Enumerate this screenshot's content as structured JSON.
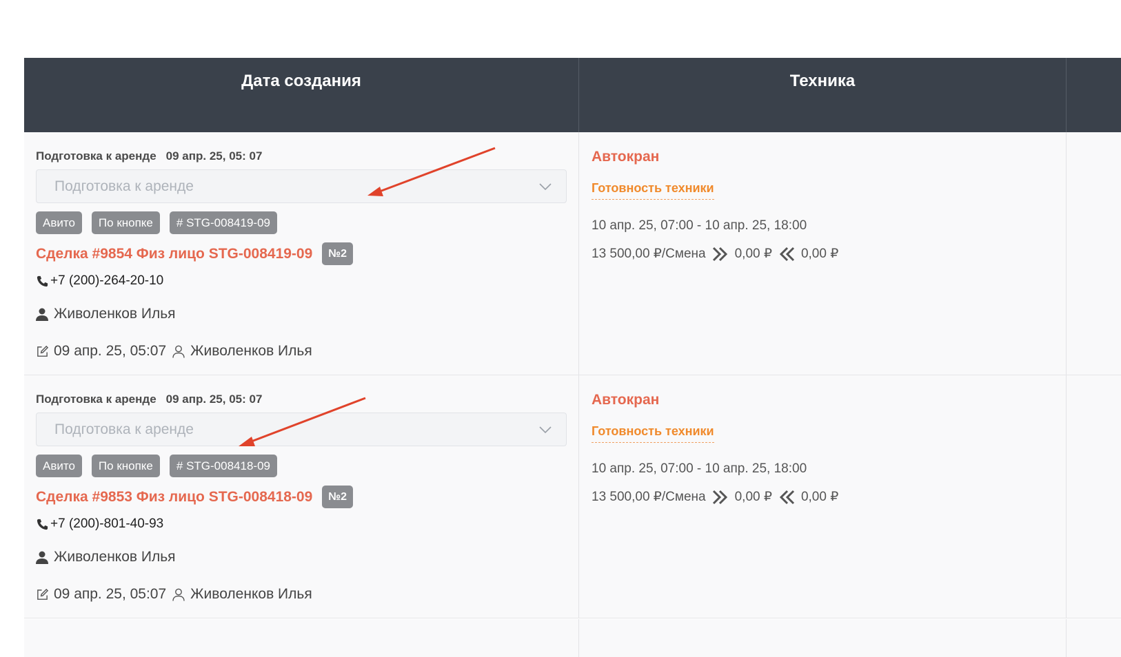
{
  "header": {
    "col_created": "Дата создания",
    "col_equipment": "Техника"
  },
  "rows": [
    {
      "status_label": "Подготовка к аренде",
      "status_date": "09 апр. 25, 05: 07",
      "select_placeholder": "Подготовка к аренде",
      "tags": [
        "Авито",
        "По кнопке",
        "# STG-008419-09"
      ],
      "deal_title": "Сделка #9854 Физ лицо STG-008419-09",
      "deal_badge": "№2",
      "phone": "+7 (200)-264-20-10",
      "manager": "Живоленков Илья",
      "edited_date": "09 апр. 25, 05:07",
      "edited_by": "Живоленков Илья",
      "equipment": "Автокран",
      "readiness": "Готовность техники",
      "period": "10 апр. 25, 07:00 - 10 апр. 25, 18:00",
      "price": "13 500,00 ₽/Смена",
      "out_amount": "0,00 ₽",
      "in_amount": "0,00 ₽"
    },
    {
      "status_label": "Подготовка к аренде",
      "status_date": "09 апр. 25, 05: 07",
      "select_placeholder": "Подготовка к аренде",
      "tags": [
        "Авито",
        "По кнопке",
        "# STG-008418-09"
      ],
      "deal_title": "Сделка #9853 Физ лицо STG-008418-09",
      "deal_badge": "№2",
      "phone": "+7 (200)-801-40-93",
      "manager": "Живоленков Илья",
      "edited_date": "09 апр. 25, 05:07",
      "edited_by": "Живоленков Илья",
      "equipment": "Автокран",
      "readiness": "Готовность техники",
      "period": "10 апр. 25, 07:00 - 10 апр. 25, 18:00",
      "price": "13 500,00 ₽/Смена",
      "out_amount": "0,00 ₽",
      "in_amount": "0,00 ₽"
    }
  ],
  "icons": {
    "chevron": "chevron-down-icon",
    "phone": "phone-icon",
    "user": "user-icon",
    "edit": "edit-icon",
    "forward": "double-chevron-right-icon",
    "back": "double-chevron-left-icon",
    "annotation": "red-arrow-annotation"
  },
  "colors": {
    "header_bg": "#3a414b",
    "accent_red": "#e5684f",
    "accent_orange": "#f08a2c",
    "tag_gray": "#8a8c90",
    "annotation_arrow": "#e0432b"
  }
}
